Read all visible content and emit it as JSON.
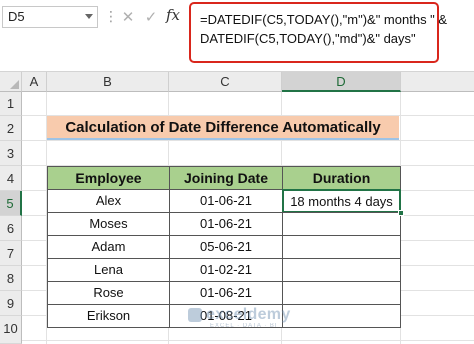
{
  "name_box": {
    "value": "D5"
  },
  "formula_bar": {
    "cancel_glyph": "✕",
    "enter_glyph": "✓",
    "fx_label": "fx",
    "formula_line1": "=DATEDIF(C5,TODAY(),\"m\")&\" months \" &",
    "formula_line2": "DATEDIF(C5,TODAY(),\"md\")&\" days\"",
    "highlight_color": "#d9261c"
  },
  "columns": [
    "A",
    "B",
    "C",
    "D"
  ],
  "rows": [
    "1",
    "2",
    "3",
    "4",
    "5",
    "6",
    "7",
    "8",
    "9",
    "10"
  ],
  "selected_cell": {
    "column": "D",
    "row": "5"
  },
  "title": {
    "text": "Calculation of Date Difference Automatically",
    "fill_color": "#f8cbad"
  },
  "table": {
    "header_color": "#a9d08e",
    "headers": [
      "Employee",
      "Joining Date",
      "Duration"
    ],
    "rows": [
      [
        "Alex",
        "01-06-21",
        "18 months 4 days"
      ],
      [
        "Moses",
        "01-06-21",
        ""
      ],
      [
        "Adam",
        "05-06-21",
        ""
      ],
      [
        "Lena",
        "01-02-21",
        ""
      ],
      [
        "Rose",
        "01-06-21",
        ""
      ],
      [
        "Erikson",
        "01-08-21",
        ""
      ]
    ]
  },
  "watermark": {
    "text": "exceldemy",
    "subtext": "EXCEL · DATA · BI",
    "icon": "exceldemy-logo-icon"
  }
}
